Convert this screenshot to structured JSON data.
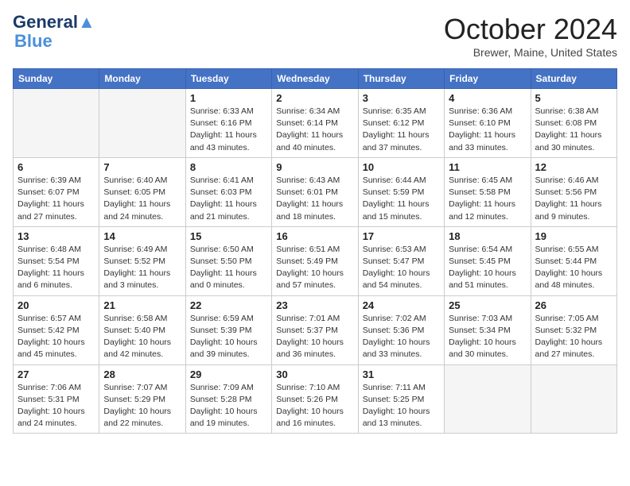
{
  "header": {
    "logo_line1": "General",
    "logo_line2": "Blue",
    "month_title": "October 2024",
    "location": "Brewer, Maine, United States"
  },
  "weekdays": [
    "Sunday",
    "Monday",
    "Tuesday",
    "Wednesday",
    "Thursday",
    "Friday",
    "Saturday"
  ],
  "weeks": [
    [
      {
        "day": "",
        "empty": true
      },
      {
        "day": "",
        "empty": true
      },
      {
        "day": "1",
        "sunrise": "6:33 AM",
        "sunset": "6:16 PM",
        "daylight": "11 hours and 43 minutes."
      },
      {
        "day": "2",
        "sunrise": "6:34 AM",
        "sunset": "6:14 PM",
        "daylight": "11 hours and 40 minutes."
      },
      {
        "day": "3",
        "sunrise": "6:35 AM",
        "sunset": "6:12 PM",
        "daylight": "11 hours and 37 minutes."
      },
      {
        "day": "4",
        "sunrise": "6:36 AM",
        "sunset": "6:10 PM",
        "daylight": "11 hours and 33 minutes."
      },
      {
        "day": "5",
        "sunrise": "6:38 AM",
        "sunset": "6:08 PM",
        "daylight": "11 hours and 30 minutes."
      }
    ],
    [
      {
        "day": "6",
        "sunrise": "6:39 AM",
        "sunset": "6:07 PM",
        "daylight": "11 hours and 27 minutes."
      },
      {
        "day": "7",
        "sunrise": "6:40 AM",
        "sunset": "6:05 PM",
        "daylight": "11 hours and 24 minutes."
      },
      {
        "day": "8",
        "sunrise": "6:41 AM",
        "sunset": "6:03 PM",
        "daylight": "11 hours and 21 minutes."
      },
      {
        "day": "9",
        "sunrise": "6:43 AM",
        "sunset": "6:01 PM",
        "daylight": "11 hours and 18 minutes."
      },
      {
        "day": "10",
        "sunrise": "6:44 AM",
        "sunset": "5:59 PM",
        "daylight": "11 hours and 15 minutes."
      },
      {
        "day": "11",
        "sunrise": "6:45 AM",
        "sunset": "5:58 PM",
        "daylight": "11 hours and 12 minutes."
      },
      {
        "day": "12",
        "sunrise": "6:46 AM",
        "sunset": "5:56 PM",
        "daylight": "11 hours and 9 minutes."
      }
    ],
    [
      {
        "day": "13",
        "sunrise": "6:48 AM",
        "sunset": "5:54 PM",
        "daylight": "11 hours and 6 minutes."
      },
      {
        "day": "14",
        "sunrise": "6:49 AM",
        "sunset": "5:52 PM",
        "daylight": "11 hours and 3 minutes."
      },
      {
        "day": "15",
        "sunrise": "6:50 AM",
        "sunset": "5:50 PM",
        "daylight": "11 hours and 0 minutes."
      },
      {
        "day": "16",
        "sunrise": "6:51 AM",
        "sunset": "5:49 PM",
        "daylight": "10 hours and 57 minutes."
      },
      {
        "day": "17",
        "sunrise": "6:53 AM",
        "sunset": "5:47 PM",
        "daylight": "10 hours and 54 minutes."
      },
      {
        "day": "18",
        "sunrise": "6:54 AM",
        "sunset": "5:45 PM",
        "daylight": "10 hours and 51 minutes."
      },
      {
        "day": "19",
        "sunrise": "6:55 AM",
        "sunset": "5:44 PM",
        "daylight": "10 hours and 48 minutes."
      }
    ],
    [
      {
        "day": "20",
        "sunrise": "6:57 AM",
        "sunset": "5:42 PM",
        "daylight": "10 hours and 45 minutes."
      },
      {
        "day": "21",
        "sunrise": "6:58 AM",
        "sunset": "5:40 PM",
        "daylight": "10 hours and 42 minutes."
      },
      {
        "day": "22",
        "sunrise": "6:59 AM",
        "sunset": "5:39 PM",
        "daylight": "10 hours and 39 minutes."
      },
      {
        "day": "23",
        "sunrise": "7:01 AM",
        "sunset": "5:37 PM",
        "daylight": "10 hours and 36 minutes."
      },
      {
        "day": "24",
        "sunrise": "7:02 AM",
        "sunset": "5:36 PM",
        "daylight": "10 hours and 33 minutes."
      },
      {
        "day": "25",
        "sunrise": "7:03 AM",
        "sunset": "5:34 PM",
        "daylight": "10 hours and 30 minutes."
      },
      {
        "day": "26",
        "sunrise": "7:05 AM",
        "sunset": "5:32 PM",
        "daylight": "10 hours and 27 minutes."
      }
    ],
    [
      {
        "day": "27",
        "sunrise": "7:06 AM",
        "sunset": "5:31 PM",
        "daylight": "10 hours and 24 minutes."
      },
      {
        "day": "28",
        "sunrise": "7:07 AM",
        "sunset": "5:29 PM",
        "daylight": "10 hours and 22 minutes."
      },
      {
        "day": "29",
        "sunrise": "7:09 AM",
        "sunset": "5:28 PM",
        "daylight": "10 hours and 19 minutes."
      },
      {
        "day": "30",
        "sunrise": "7:10 AM",
        "sunset": "5:26 PM",
        "daylight": "10 hours and 16 minutes."
      },
      {
        "day": "31",
        "sunrise": "7:11 AM",
        "sunset": "5:25 PM",
        "daylight": "10 hours and 13 minutes."
      },
      {
        "day": "",
        "empty": true
      },
      {
        "day": "",
        "empty": true
      }
    ]
  ]
}
